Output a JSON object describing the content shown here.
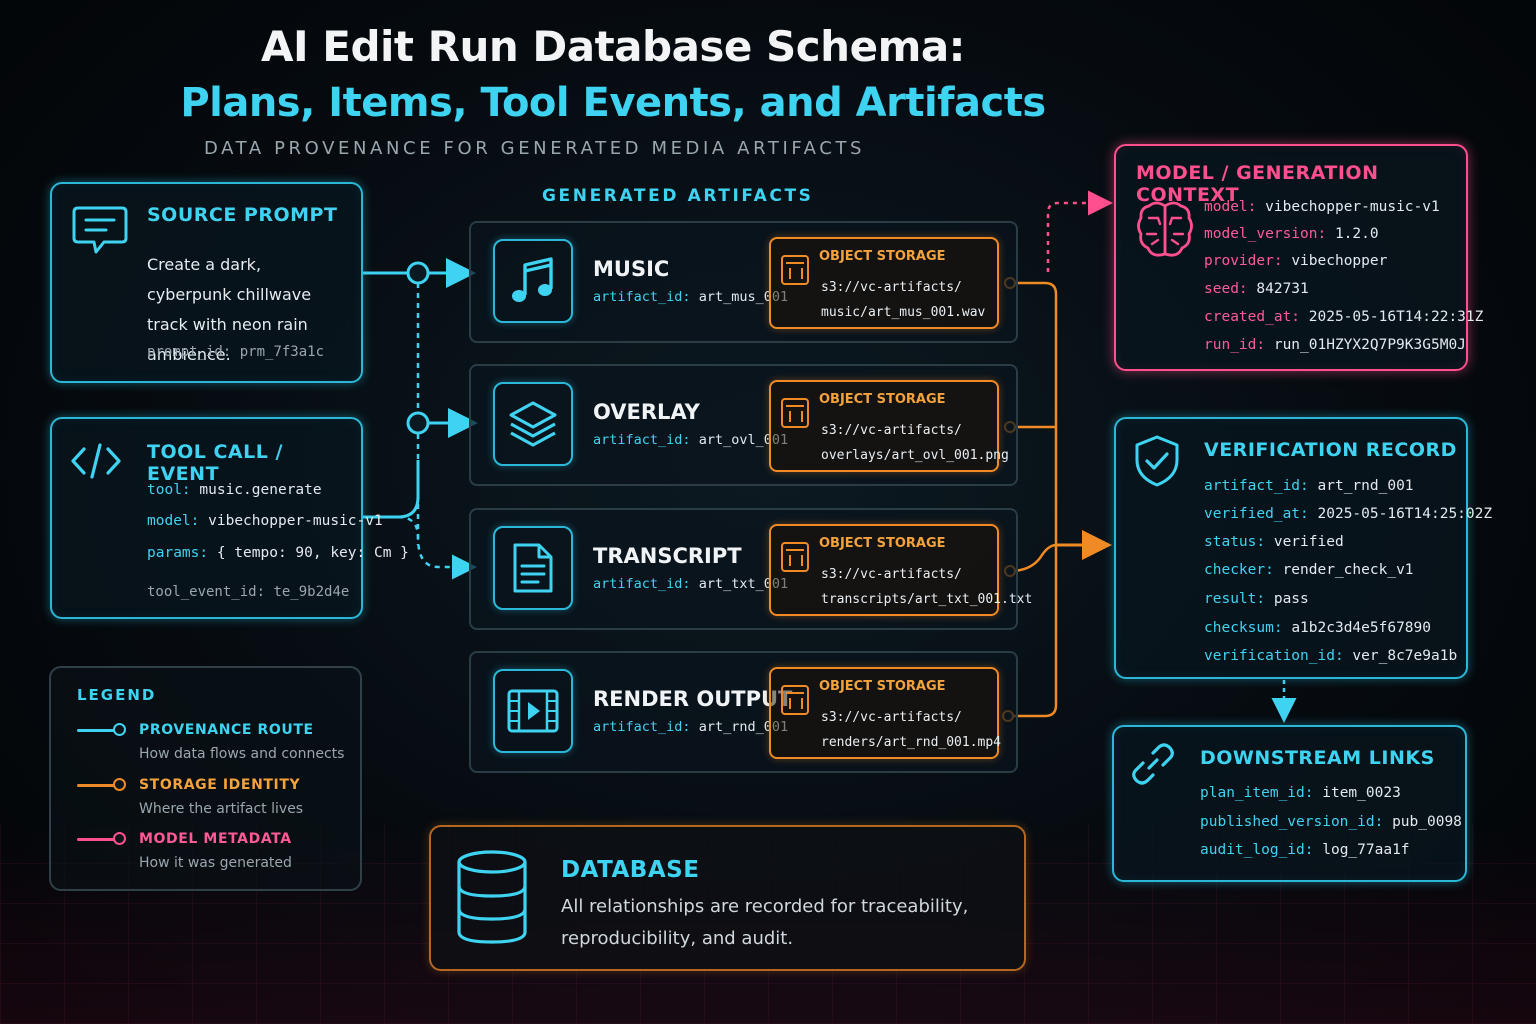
{
  "header": {
    "title": "AI Edit Run Database Schema:",
    "subtitle": "Plans, Items, Tool Events, and Artifacts",
    "tagline": "DATA PROVENANCE FOR GENERATED MEDIA ARTIFACTS"
  },
  "source_prompt": {
    "title": "SOURCE PROMPT",
    "text": "Create a dark, cyberpunk chillwave track with neon rain ambience.",
    "id_label": "prompt_id:",
    "id_value": "prm_7f3a1c",
    "icon": "chat-bubble-icon"
  },
  "tool_call": {
    "title": "TOOL CALL / EVENT",
    "icon": "code-icon",
    "fields": [
      {
        "label": "tool:",
        "value": "music.generate"
      },
      {
        "label": "model:",
        "value": "vibechopper-music-v1"
      },
      {
        "label": "params:",
        "value": "{ tempo: 90, key: Cm }"
      }
    ],
    "id_label": "tool_event_id:",
    "id_value": "te_9b2d4e"
  },
  "artifacts": {
    "section_title": "GENERATED ARTIFACTS",
    "id_label": "artifact_id:",
    "storage_title": "OBJECT STORAGE",
    "items": [
      {
        "name": "MUSIC",
        "id": "art_mus_001",
        "icon": "music-note-icon",
        "path1": "s3://vc-artifacts/",
        "path2": "music/art_mus_001.wav"
      },
      {
        "name": "OVERLAY",
        "id": "art_ovl_001",
        "icon": "layers-icon",
        "path1": "s3://vc-artifacts/",
        "path2": "overlays/art_ovl_001.png"
      },
      {
        "name": "TRANSCRIPT",
        "id": "art_txt_001",
        "icon": "document-icon",
        "path1": "s3://vc-artifacts/",
        "path2": "transcripts/art_txt_001.txt"
      },
      {
        "name": "RENDER OUTPUT",
        "id": "art_rnd_001",
        "icon": "film-play-icon",
        "path1": "s3://vc-artifacts/",
        "path2": "renders/art_rnd_001.mp4"
      }
    ]
  },
  "model_context": {
    "title": "MODEL / GENERATION CONTEXT",
    "icon": "brain-icon",
    "fields": [
      {
        "label": "model:",
        "value": "vibechopper-music-v1"
      },
      {
        "label": "model_version:",
        "value": "1.2.0"
      },
      {
        "label": "provider:",
        "value": "vibechopper"
      },
      {
        "label": "seed:",
        "value": "842731"
      },
      {
        "label": "created_at:",
        "value": "2025-05-16T14:22:31Z"
      },
      {
        "label": "run_id:",
        "value": "run_01HZYX2Q7P9K3G5M0J"
      }
    ]
  },
  "verification": {
    "title": "VERIFICATION RECORD",
    "icon": "shield-check-icon",
    "fields": [
      {
        "label": "artifact_id:",
        "value": "art_rnd_001"
      },
      {
        "label": "verified_at:",
        "value": "2025-05-16T14:25:02Z"
      },
      {
        "label": "status:",
        "value": "verified"
      },
      {
        "label": "checker:",
        "value": "render_check_v1"
      },
      {
        "label": "result:",
        "value": "pass"
      },
      {
        "label": "checksum:",
        "value": "a1b2c3d4e5f67890"
      },
      {
        "label": "verification_id:",
        "value": "ver_8c7e9a1b"
      }
    ]
  },
  "downstream": {
    "title": "DOWNSTREAM LINKS",
    "icon": "link-icon",
    "fields": [
      {
        "label": "plan_item_id:",
        "value": "item_0023"
      },
      {
        "label": "published_version_id:",
        "value": "pub_0098"
      },
      {
        "label": "audit_log_id:",
        "value": "log_77aa1f"
      }
    ]
  },
  "legend": {
    "title": "LEGEND",
    "items": [
      {
        "name": "PROVENANCE ROUTE",
        "desc": "How data flows and connects",
        "color": "#3fd3f2"
      },
      {
        "name": "STORAGE IDENTITY",
        "desc": "Where the artifact lives",
        "color": "#f08a24"
      },
      {
        "name": "MODEL METADATA",
        "desc": "How it was generated",
        "color": "#ff4f8e"
      }
    ]
  },
  "database": {
    "title": "DATABASE",
    "text": "All relationships are recorded for traceability, reproducibility, and audit.",
    "icon": "database-icon"
  },
  "colors": {
    "provenance": "#3fd3f2",
    "storage": "#f08a24",
    "model": "#ff4f8e"
  }
}
